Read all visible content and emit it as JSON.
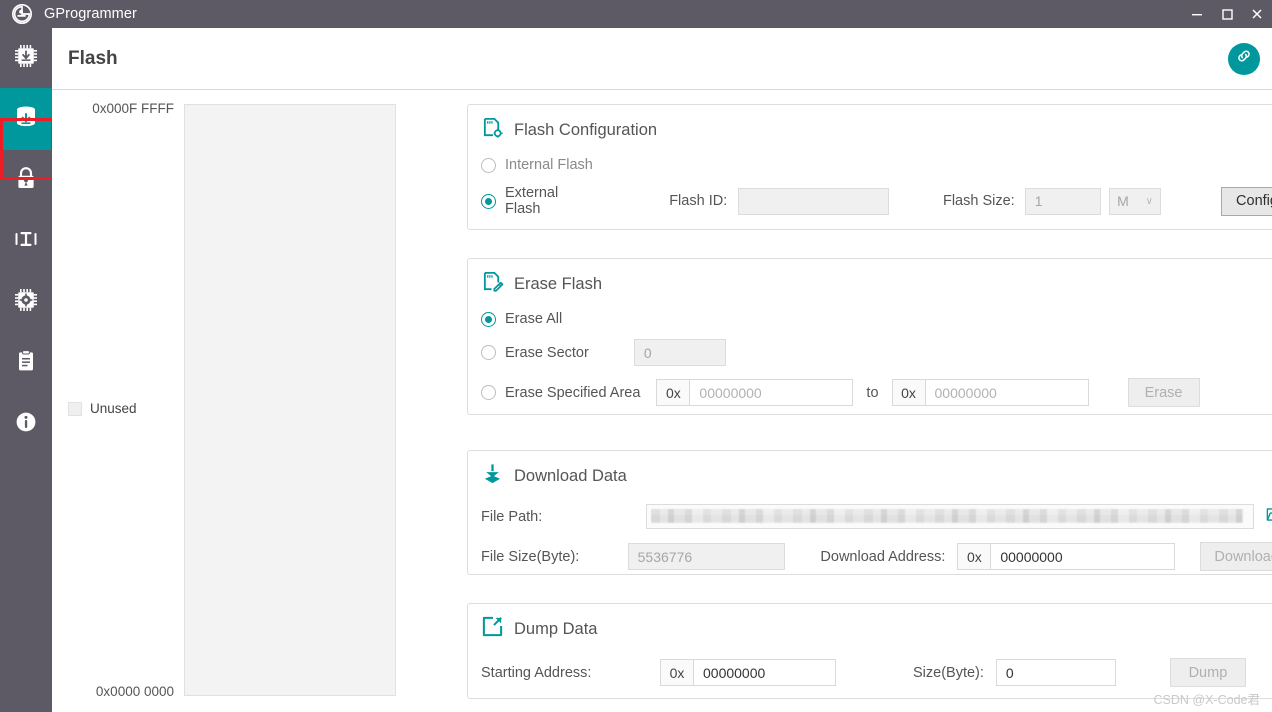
{
  "window": {
    "title": "GProgrammer",
    "logo_icon": "gprogrammer-logo-icon",
    "minimize_icon": "minimize-icon",
    "maximize_icon": "maximize-icon",
    "close_icon": "close-icon"
  },
  "colors": {
    "titlebar": "#5d5a66",
    "accent_teal": "#00989d",
    "highlight_red": "#ee1c25",
    "panel_border": "#dddddd",
    "text": "#555555"
  },
  "sidebar": {
    "items": [
      {
        "name": "chip-download-icon",
        "label": "Chip Download",
        "selected": false
      },
      {
        "name": "flash-icon",
        "label": "Flash",
        "selected": true
      },
      {
        "name": "lock-icon",
        "label": "Security",
        "selected": false
      },
      {
        "name": "io-measure-icon",
        "label": "IO Test",
        "selected": false
      },
      {
        "name": "chip-settings-icon",
        "label": "Chip Configuration",
        "selected": false
      },
      {
        "name": "clipboard-icon",
        "label": "Log",
        "selected": false
      },
      {
        "name": "info-icon",
        "label": "About",
        "selected": false
      }
    ]
  },
  "header": {
    "title": "Flash",
    "link_button_icon": "link-icon"
  },
  "memory_map": {
    "top_address": "0x000F FFFF",
    "bottom_address": "0x0000 0000",
    "legend_label": "Unused"
  },
  "panels": {
    "flash_configuration": {
      "icon": "flash-config-icon",
      "title": "Flash Configuration",
      "internal_flash_label": "Internal Flash",
      "internal_flash_selected": false,
      "external_flash_label": "External Flash",
      "external_flash_selected": true,
      "flash_id_label": "Flash ID:",
      "flash_id_value": "",
      "flash_size_label": "Flash Size:",
      "flash_size_placeholder": "1",
      "flash_size_value": "",
      "unit_value": "M",
      "unit_caret": "∨",
      "config_button": "Config"
    },
    "erase_flash": {
      "icon": "erase-flash-icon",
      "title": "Erase Flash",
      "erase_all_label": "Erase All",
      "erase_all_selected": true,
      "erase_sector_label": "Erase Sector",
      "erase_sector_selected": false,
      "erase_sector_placeholder": "0",
      "erase_sector_value": "",
      "erase_area_label": "Erase Specified Area",
      "erase_area_selected": false,
      "hex_prefix": "0x",
      "area_start_placeholder": "00000000",
      "area_start_value": "",
      "to_label": "to",
      "area_end_placeholder": "00000000",
      "area_end_value": "",
      "erase_button": "Erase",
      "erase_button_disabled": true
    },
    "download_data": {
      "icon": "download-data-icon",
      "title": "Download Data",
      "file_path_label": "File Path:",
      "file_path_value": "",
      "browse_icon": "open-folder-icon",
      "file_size_label": "File Size(Byte):",
      "file_size_value": "5536776",
      "download_address_label": "Download Address:",
      "hex_prefix": "0x",
      "download_address_value": "00000000",
      "download_button": "Download",
      "download_button_disabled": true
    },
    "dump_data": {
      "icon": "dump-data-icon",
      "title": "Dump Data",
      "starting_address_label": "Starting Address:",
      "hex_prefix": "0x",
      "starting_address_value": "00000000",
      "size_label": "Size(Byte):",
      "size_value": "0",
      "dump_button": "Dump",
      "dump_button_disabled": true
    }
  },
  "watermark": "CSDN @X-Code君"
}
